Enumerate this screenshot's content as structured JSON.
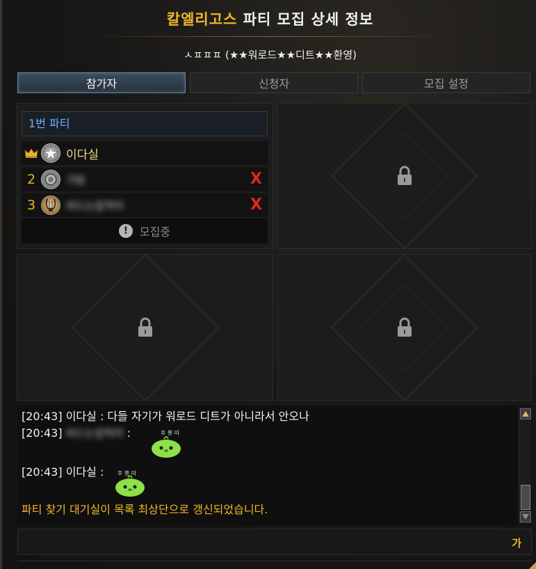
{
  "window": {
    "title_server": "칼엘리고스",
    "title_rest": "파티 모집 상세 정보",
    "party_name": "ㅅㅍㅍㅍ (★★워로드★★디트★★환영)"
  },
  "tabs": [
    {
      "label": "참가자",
      "active": true
    },
    {
      "label": "신청자",
      "active": false
    },
    {
      "label": "모집 설정",
      "active": false
    }
  ],
  "party1": {
    "header": "1번 파티",
    "members": [
      {
        "slot": "crown",
        "name": "이다실",
        "blurred": false,
        "kickable": false
      },
      {
        "slot": "2",
        "name": "가람",
        "blurred": true,
        "kickable": true
      },
      {
        "slot": "3",
        "name": "바드는잡먹어",
        "blurred": true,
        "kickable": true
      }
    ],
    "recruit_label": "모집중",
    "kick_label": "X",
    "info_glyph": "!"
  },
  "chat": {
    "lines": [
      {
        "time": "[20:43]",
        "sender": "이다실",
        "text": ": 다들 자기가 워로드 디트가 아니라서 안오나"
      },
      {
        "time": "[20:43]",
        "sender": "바드는잡먹어",
        "text": ":"
      },
      {
        "time": "[20:43]",
        "sender": "이다실",
        "text": ":"
      }
    ],
    "system_message": "파티 찾기 대기실이 목록 최상단으로 갱신되었습니다.",
    "emote_caption": "후 뿅 따"
  },
  "input": {
    "ime_label": "가"
  },
  "colors": {
    "accent_gold": "#f0b52a",
    "party_header_blue": "#6eb2ff",
    "kick_red": "#e0281c",
    "emote_green": "#8ee04a"
  }
}
